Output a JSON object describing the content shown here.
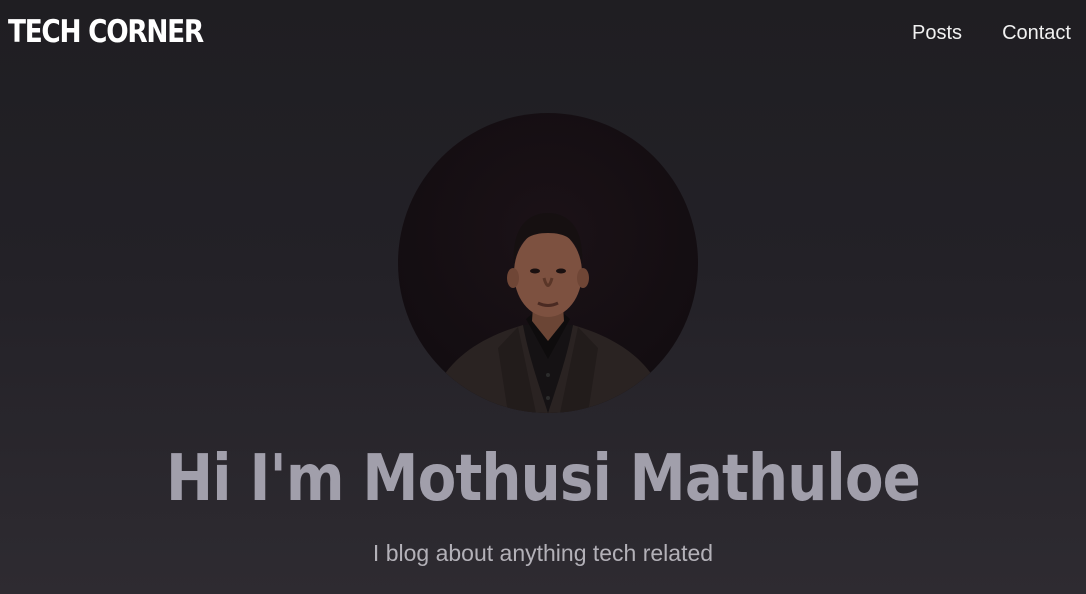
{
  "nav": {
    "brand": "TECH CORNER",
    "links": [
      {
        "label": "Posts"
      },
      {
        "label": "Contact"
      }
    ]
  },
  "hero": {
    "title": "Hi I'm Mothusi Mathuloe",
    "subtitle": "I blog about anything tech related"
  },
  "colors": {
    "background_top": "#1f1e22",
    "background_bottom": "#2e2b31",
    "title": "#a19fab",
    "subtitle": "#b3b1b8",
    "nav_text": "#f1f1f1"
  }
}
